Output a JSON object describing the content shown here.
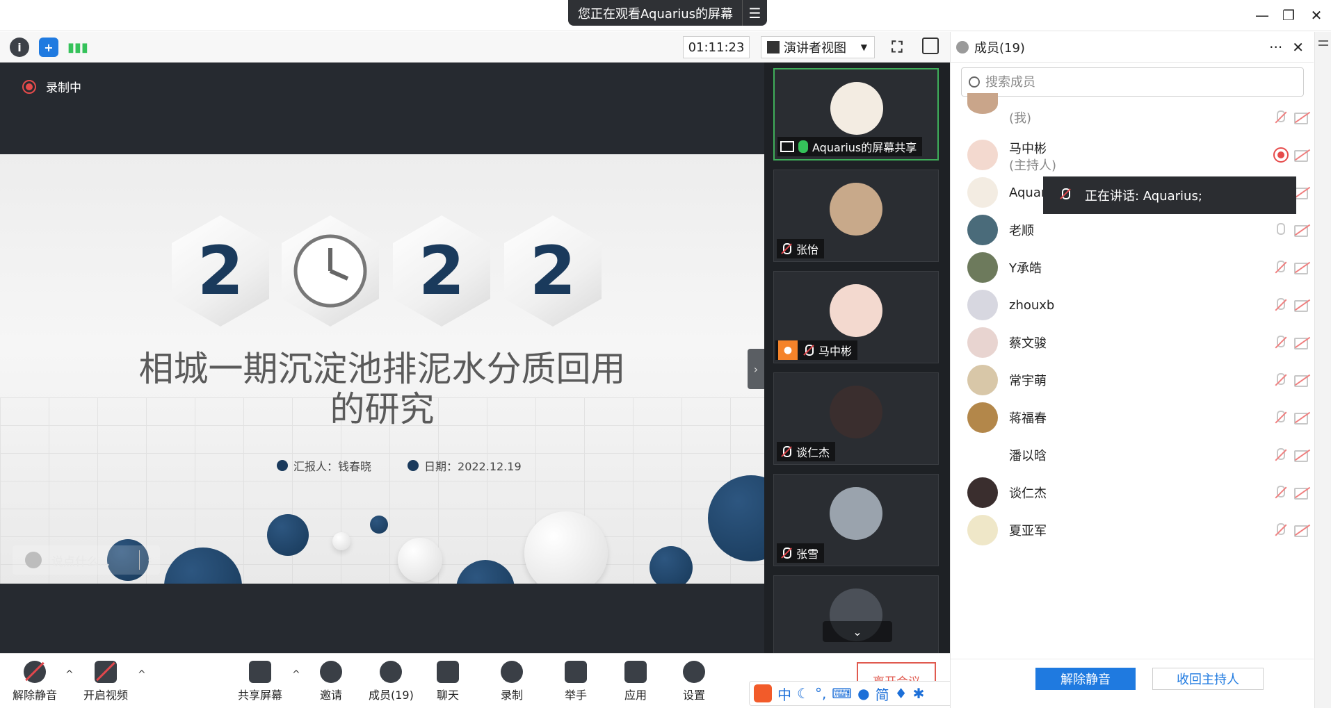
{
  "share_banner": {
    "text": "您正在观看Aquarius的屏幕",
    "menu_icon": "menu-icon"
  },
  "window": {
    "minimize": "—",
    "restore": "❐",
    "close": "✕"
  },
  "toolbar": {
    "timer": "01:11:23",
    "view_mode": "演讲者视图"
  },
  "stage": {
    "recording_label": "录制中",
    "chat_placeholder": "说点什么..."
  },
  "slide": {
    "year_digits": [
      "2",
      "",
      "2",
      "2"
    ],
    "title_line1": "相城一期沉淀池排泥水分质回用",
    "title_line2": "的研究",
    "reporter": "汇报人：钱春晓",
    "date": "日期：2022.12.19"
  },
  "gallery": [
    {
      "name": "Aquarius的屏幕共享",
      "mic": "on",
      "active": true,
      "color": "#f3ece2"
    },
    {
      "name": "张怡",
      "mic": "off",
      "active": false,
      "color": "#c8a98a"
    },
    {
      "name": "马中彬",
      "mic": "off",
      "active": false,
      "host": true,
      "color": "#f3d9cf"
    },
    {
      "name": "谈仁杰",
      "mic": "off",
      "active": false,
      "color": "#3a2e2e"
    },
    {
      "name": "张雪",
      "mic": "off",
      "active": false,
      "color": "#9aa3ad"
    }
  ],
  "bottom": {
    "unmute": "解除静音",
    "video": "开启视频",
    "share": "共享屏幕",
    "invite": "邀请",
    "members": "成员(19)",
    "chat": "聊天",
    "record": "录制",
    "raise_hand": "举手",
    "apps": "应用",
    "settings": "设置",
    "leave": "离开会议"
  },
  "ime": {
    "lang": "中",
    "mode": "简"
  },
  "panel": {
    "title": "成员(19)",
    "search_placeholder": "搜索成员",
    "speaking_tip": "正在讲话: Aquarius;",
    "members": [
      {
        "name": "",
        "sub": "(我)",
        "mic": "off",
        "color": "#c9a58a"
      },
      {
        "name": "马中彬",
        "sub": "(主持人)",
        "mic": "rec",
        "color": "#f3d9cf"
      },
      {
        "name": "Aquar",
        "sub": "",
        "mic": "off",
        "color": "#f3ece2"
      },
      {
        "name": "老顺",
        "sub": "",
        "mic": "on",
        "color": "#4a6b7a"
      },
      {
        "name": "Y承皓",
        "sub": "",
        "mic": "off",
        "color": "#6d7a5c"
      },
      {
        "name": "zhouxb",
        "sub": "",
        "mic": "off",
        "color": "#d7d7e0"
      },
      {
        "name": "蔡文骏",
        "sub": "",
        "mic": "off",
        "color": "#e8d4d0"
      },
      {
        "name": "常宇萌",
        "sub": "",
        "mic": "off",
        "color": "#d8c7a8"
      },
      {
        "name": "蒋福春",
        "sub": "",
        "mic": "off",
        "color": "#b3874a"
      },
      {
        "name": "潘以晗",
        "sub": "",
        "mic": "off",
        "color": "#ffffff"
      },
      {
        "name": "谈仁杰",
        "sub": "",
        "mic": "off",
        "color": "#3a2e2e"
      },
      {
        "name": "夏亚军",
        "sub": "",
        "mic": "off",
        "color": "#efe7c8"
      }
    ],
    "unmute_all": "解除静音",
    "reclaim_host": "收回主持人"
  }
}
